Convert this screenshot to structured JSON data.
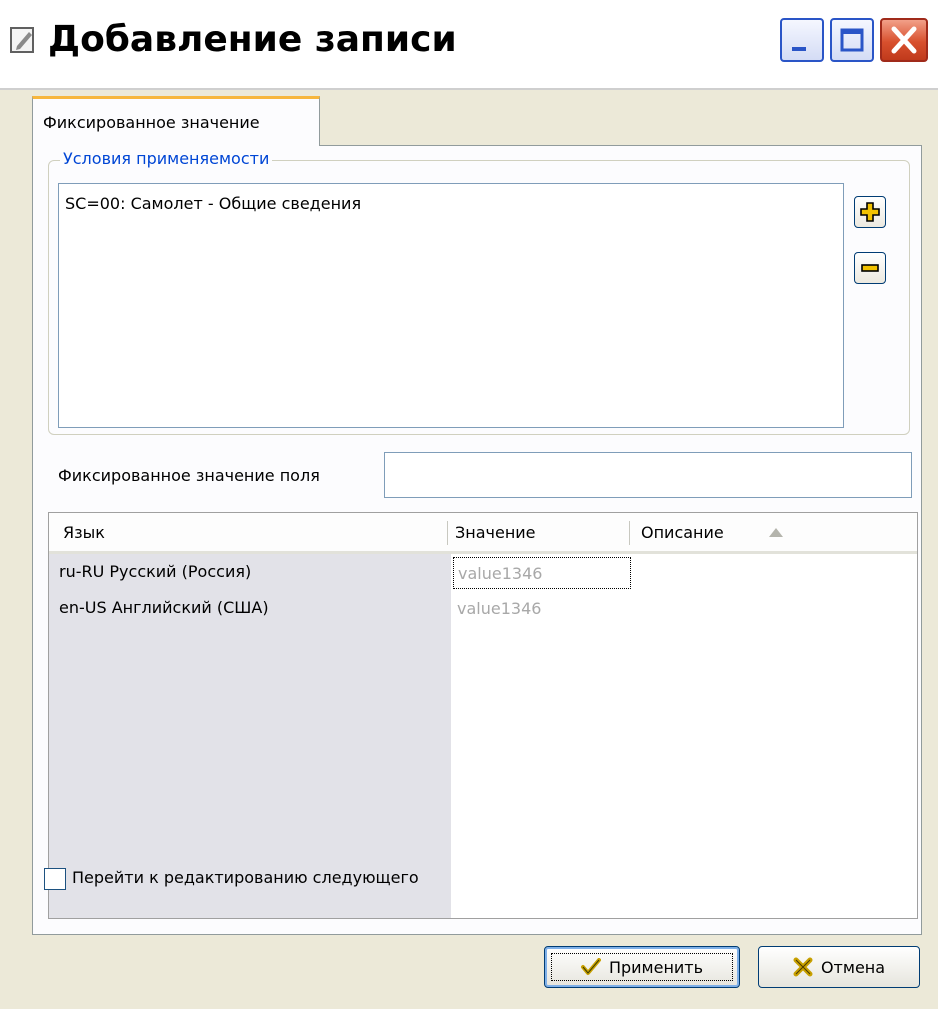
{
  "window": {
    "title": "Добавление записи"
  },
  "tabs": [
    {
      "label": "Фиксированное значение",
      "active": true
    }
  ],
  "conditions_group": {
    "legend": "Условия применяемости",
    "items": [
      "SC=00: Самолет - Общие сведения"
    ],
    "add_icon": "plus-icon",
    "remove_icon": "minus-icon"
  },
  "fixed_value": {
    "label": "Фиксированное значение поля",
    "value": ""
  },
  "grid": {
    "columns": [
      "Язык",
      "Значение",
      "Описание"
    ],
    "sort_icon": "sort-ascending-icon",
    "rows": [
      {
        "language": "ru-RU  Русский (Россия)",
        "value": "value1346",
        "description": ""
      },
      {
        "language": "en-US  Английский (США)",
        "value": "value1346",
        "description": ""
      }
    ]
  },
  "footer": {
    "checkbox_label": "Перейти к редактированию следующего",
    "checkbox_checked": false,
    "apply_label": "Применить",
    "apply_icon": "checkmark-icon",
    "cancel_label": "Отмена",
    "cancel_icon": "cross-icon"
  },
  "colors": {
    "group_legend": "#0046d5",
    "tab_accent": "#f7b63c",
    "close_button": "#d8502e"
  }
}
